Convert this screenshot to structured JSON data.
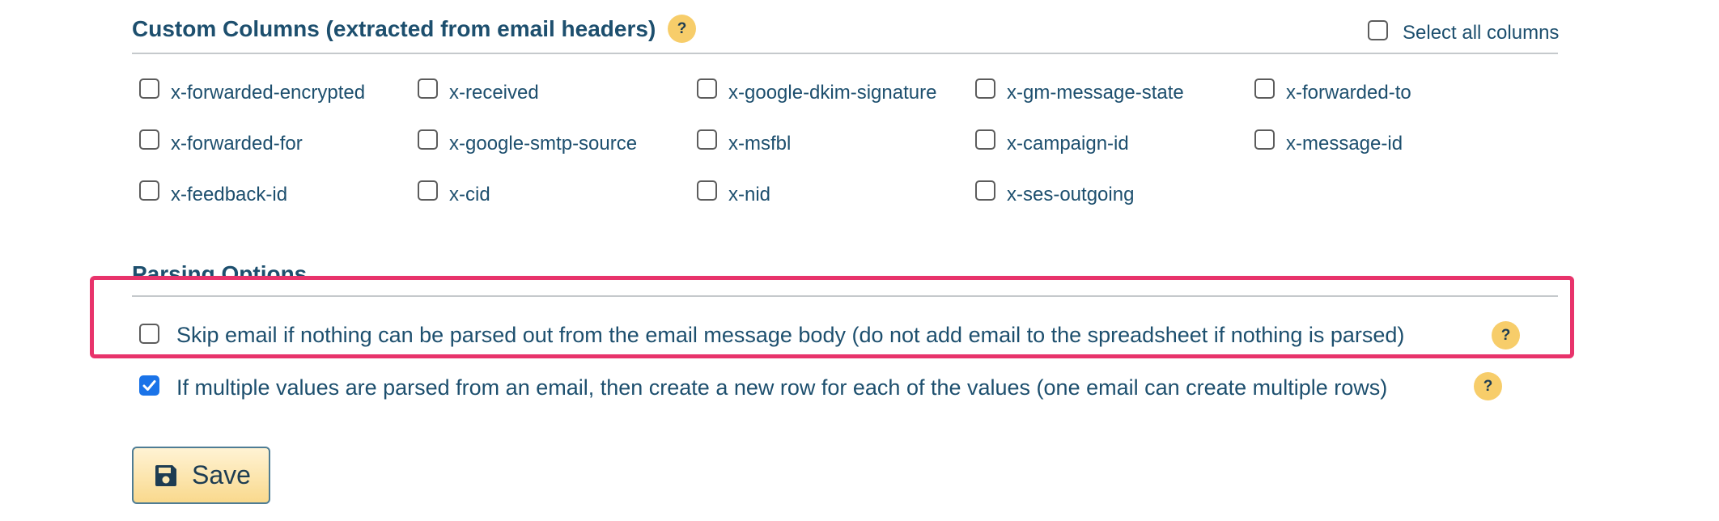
{
  "custom_columns": {
    "title": "Custom Columns (extracted from email headers)",
    "help": "?",
    "select_all_label": "Select all columns",
    "columns": [
      [
        "x-forwarded-encrypted",
        "x-received",
        "x-google-dkim-signature",
        "x-gm-message-state",
        "x-forwarded-to"
      ],
      [
        "x-forwarded-for",
        "x-google-smtp-source",
        "x-msfbl",
        "x-campaign-id",
        "x-message-id"
      ],
      [
        "x-feedback-id",
        "x-cid",
        "x-nid",
        "x-ses-outgoing"
      ]
    ]
  },
  "parsing_options": {
    "title": "Parsing Options",
    "options": [
      {
        "label": "Skip email if nothing can be parsed out from the email message body (do not add email to the spreadsheet if nothing is parsed)",
        "checked": false,
        "help": "?"
      },
      {
        "label": "If multiple values are parsed from an email, then create a new row for each of the values (one email can create multiple rows)",
        "checked": true,
        "help": "?"
      }
    ]
  },
  "save_button": {
    "label": "Save",
    "icon": "floppy-disk-icon"
  },
  "colors": {
    "text": "#1d4f6e",
    "help_badge": "#f7cd6a",
    "highlight": "#e8336b",
    "checkbox_checked": "#1a73e8"
  }
}
